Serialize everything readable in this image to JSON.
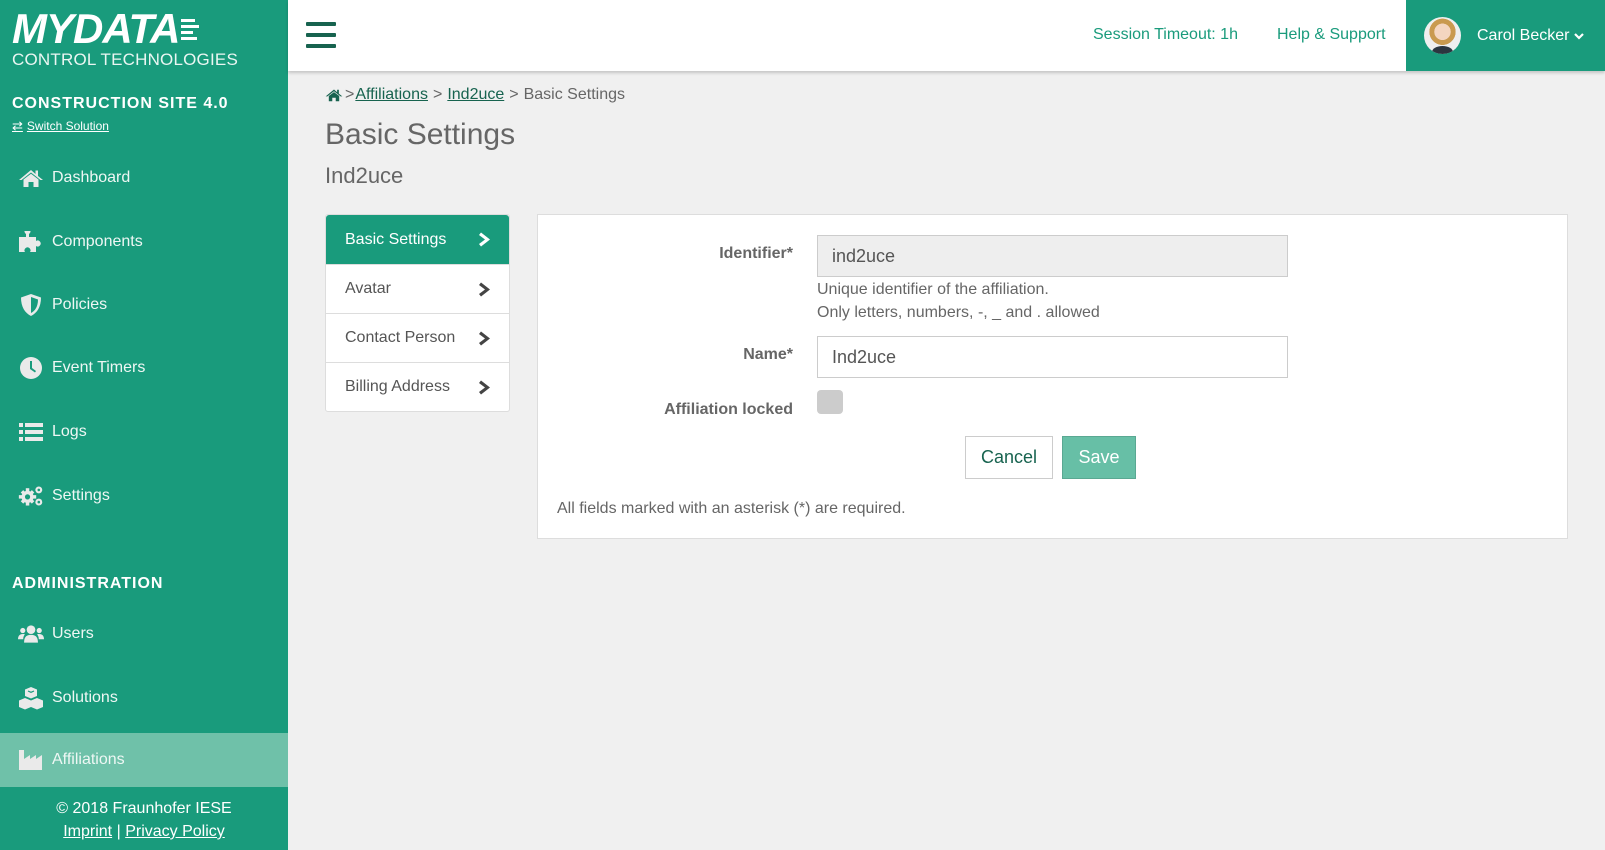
{
  "sidebar": {
    "logo": {
      "brand": "MYDATA",
      "subtitle": "CONTROL TECHNOLOGIES"
    },
    "solution_title": "CONSTRUCTION SITE 4.0",
    "switch_solution": {
      "label": "Switch Solution",
      "icon": "exchange-icon"
    },
    "items": [
      {
        "label": "Dashboard",
        "icon": "home-icon"
      },
      {
        "label": "Components",
        "icon": "puzzle-piece-icon"
      },
      {
        "label": "Policies",
        "icon": "shield-icon"
      },
      {
        "label": "Event Timers",
        "icon": "clock-icon"
      },
      {
        "label": "Logs",
        "icon": "list-icon"
      },
      {
        "label": "Settings",
        "icon": "cogs-icon"
      }
    ],
    "admin_title": "ADMINISTRATION",
    "admin_items": [
      {
        "label": "Users",
        "icon": "users-icon"
      },
      {
        "label": "Solutions",
        "icon": "cubes-icon"
      },
      {
        "label": "Affiliations",
        "icon": "industry-icon",
        "active": true
      }
    ],
    "footer": {
      "copyright": "© 2018 Fraunhofer IESE",
      "imprint": "Imprint",
      "separator": "|",
      "privacy": "Privacy Policy"
    }
  },
  "header": {
    "menu_icon": "hamburger-icon",
    "session_timeout": "Session Timeout: 1h",
    "help": "Help & Support",
    "user": {
      "name": "Carol Becker",
      "icon": "chevron-down-icon"
    }
  },
  "breadcrumb": {
    "home_icon": "home-icon",
    "items": [
      "Affiliations",
      "Ind2uce"
    ],
    "current": "Basic Settings",
    "separator": ">"
  },
  "page": {
    "title": "Basic Settings",
    "subtitle": "Ind2uce"
  },
  "subnav": {
    "items": [
      {
        "label": "Basic Settings",
        "active": true
      },
      {
        "label": "Avatar"
      },
      {
        "label": "Contact Person"
      },
      {
        "label": "Billing Address"
      }
    ]
  },
  "form": {
    "identifier": {
      "label": "Identifier*",
      "value": "ind2uce",
      "help_1": "Unique identifier of the affiliation.",
      "help_2": "Only letters, numbers, -, _ and . allowed"
    },
    "name": {
      "label": "Name*",
      "value": "Ind2uce"
    },
    "locked": {
      "label": "Affiliation locked",
      "checked": false
    },
    "cancel": "Cancel",
    "save": "Save",
    "required_note": "All fields marked with an asterisk (*) are required."
  },
  "colors": {
    "primary": "#199b7c",
    "primary_light": "#6fc1a9",
    "dark_green": "#17634f",
    "save_button": "#67bfa6",
    "background": "#f0f0f0"
  }
}
